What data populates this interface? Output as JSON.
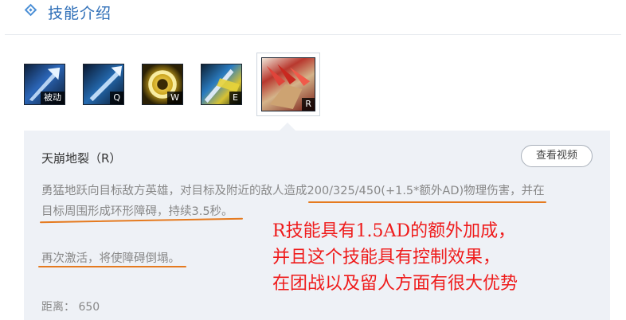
{
  "header": {
    "title": "技能介绍"
  },
  "skills": [
    {
      "key": "被动",
      "icon": "passive-skill-icon"
    },
    {
      "key": "Q",
      "icon": "q-skill-icon"
    },
    {
      "key": "W",
      "icon": "w-skill-icon"
    },
    {
      "key": "E",
      "icon": "e-skill-icon"
    },
    {
      "key": "R",
      "icon": "r-skill-icon",
      "selected": true
    }
  ],
  "detail": {
    "name": "天崩地裂（R）",
    "video_button": "查看视频",
    "description_line1": "勇猛地跃向目标敌方英雄，对目标及附近的敌人造成200/325/450(+1.5*额外AD)物理伤害，并在",
    "description_line2": "目标周围形成环形障碍，持续3.5秒。",
    "description_line3": "再次激活，将使障碍倒塌。",
    "range": "距离： 650"
  },
  "annotation": {
    "line1": "R技能具有1.5AD的额外加成，",
    "line2": "并且这个技能具有控制效果，",
    "line3": "在团战以及留人方面有很大优势"
  },
  "colors": {
    "accent": "#2f6fb8",
    "annotation": "#ef1b1b",
    "underline": "#e57a1f",
    "panel": "#eef1f6"
  }
}
